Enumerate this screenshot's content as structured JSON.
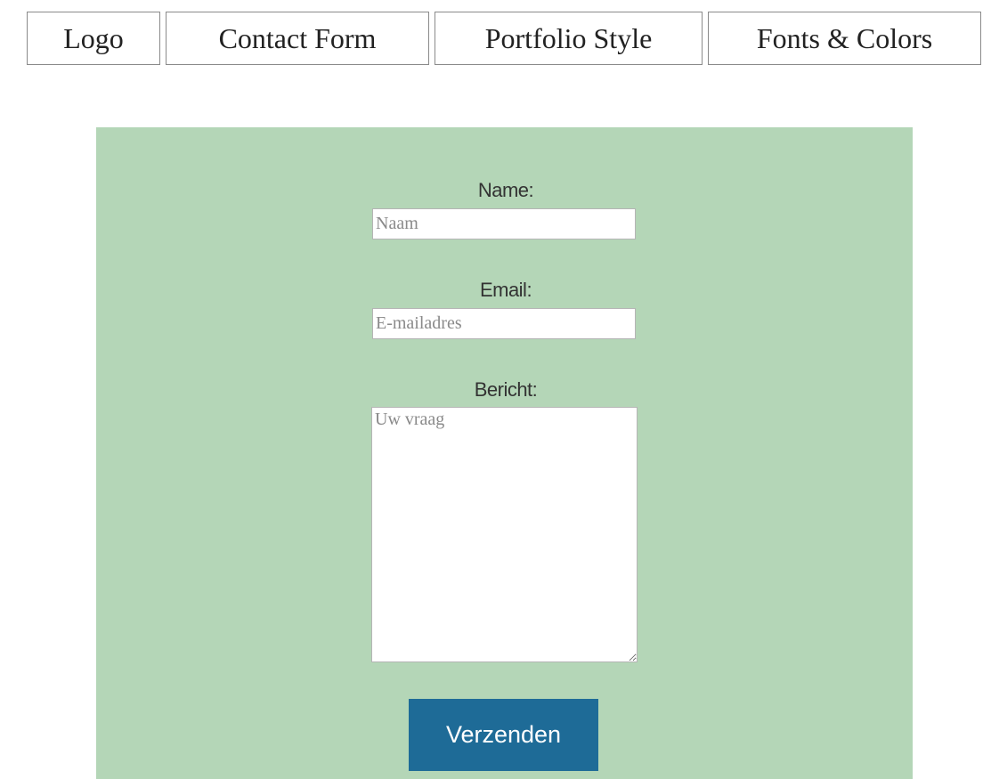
{
  "tabs": [
    {
      "label": "Logo"
    },
    {
      "label": "Contact Form"
    },
    {
      "label": "Portfolio Style"
    },
    {
      "label": "Fonts & Colors"
    }
  ],
  "form": {
    "name": {
      "label": "Name:",
      "placeholder": "Naam",
      "value": ""
    },
    "email": {
      "label": "Email:",
      "placeholder": "E-mailadres",
      "value": ""
    },
    "message": {
      "label": "Bericht:",
      "placeholder": "Uw vraag",
      "value": ""
    },
    "submit_label": "Verzenden"
  },
  "colors": {
    "panel_background": "#b4d6b7",
    "button_background": "#1e6b97",
    "button_text": "#ffffff"
  }
}
